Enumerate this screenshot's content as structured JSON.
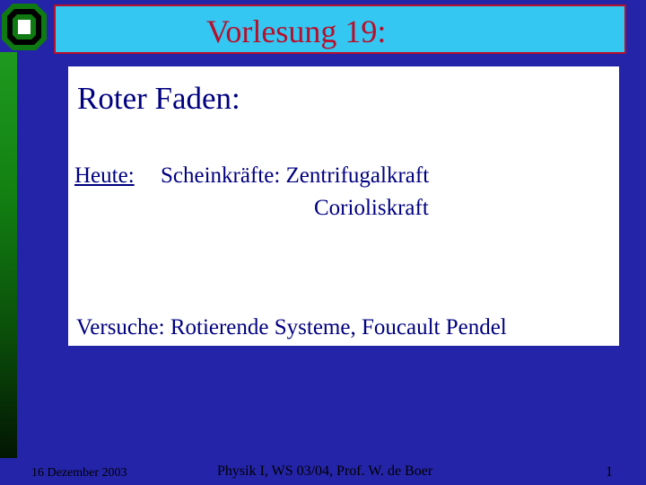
{
  "title": "Vorlesung 19:",
  "content": {
    "heading": "Roter Faden:",
    "heute_label": "Heute:",
    "heute_line1": "Scheinkräfte: Zentrifugalkraft",
    "heute_line2": "Corioliskraft",
    "versuche": "Versuche: Rotierende Systeme, Foucault Pendel"
  },
  "footer": {
    "date": "16 Dezember 2003",
    "course": "Physik I,  WS 03/04,  Prof. W. de Boer",
    "page": "1"
  },
  "colors": {
    "background": "#2424a8",
    "title_bg": "#33c7f2",
    "title_text": "#b80f2a",
    "content_text": "#000080",
    "sidebar": "#128012"
  },
  "icons": {
    "logo": "university-logo-icon"
  }
}
